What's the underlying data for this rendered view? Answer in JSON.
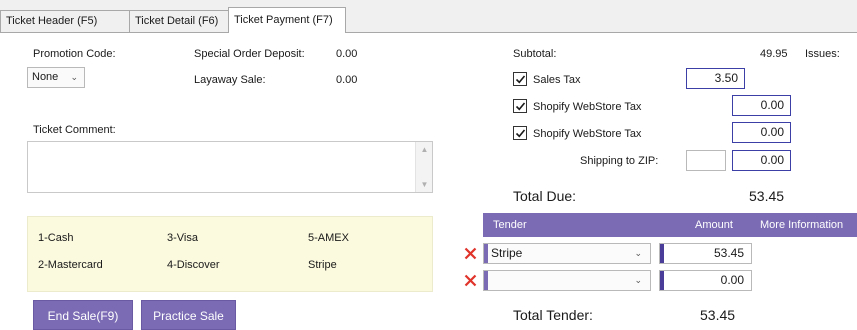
{
  "tabs": [
    {
      "label": "Ticket Header (F5)"
    },
    {
      "label": "Ticket Detail (F6)"
    },
    {
      "label": "Ticket Payment (F7)"
    }
  ],
  "left": {
    "promotion_code_label": "Promotion Code:",
    "promotion_code_value": "None",
    "special_order_deposit_label": "Special Order Deposit:",
    "special_order_deposit_value": "0.00",
    "layaway_sale_label": "Layaway Sale:",
    "layaway_sale_value": "0.00",
    "ticket_comment_label": "Ticket Comment:",
    "ticket_comment_value": "",
    "tender_options": [
      "1-Cash",
      "3-Visa",
      "5-AMEX",
      "2-Mastercard",
      "4-Discover",
      "Stripe"
    ],
    "end_sale_label": "End Sale(F9)",
    "practice_sale_label": "Practice Sale"
  },
  "right": {
    "subtotal_label": "Subtotal:",
    "subtotal_value": "49.95",
    "issues_label": "Issues:",
    "sales_tax_label": "Sales Tax",
    "sales_tax_value": "3.50",
    "shopify_tax_1_label": "Shopify WebStore Tax",
    "shopify_tax_1_value": "0.00",
    "shopify_tax_2_label": "Shopify WebStore Tax",
    "shopify_tax_2_value": "0.00",
    "shipping_label": "Shipping to ZIP:",
    "shipping_zip_value": "",
    "shipping_value": "0.00",
    "total_due_label": "Total Due:",
    "total_due_value": "53.45",
    "tender_header": {
      "tender": "Tender",
      "amount": "Amount",
      "more_info": "More Information"
    },
    "tender_rows": [
      {
        "tender": "Stripe",
        "amount": "53.45"
      },
      {
        "tender": "",
        "amount": "0.00"
      }
    ],
    "total_tender_label": "Total Tender:",
    "total_tender_value": "53.45"
  },
  "colors": {
    "accent": "#7b6bb4",
    "tender_panel_bg": "#fbf9de",
    "remove_x": "#e0332a",
    "input_border": "#3c3fa5"
  }
}
